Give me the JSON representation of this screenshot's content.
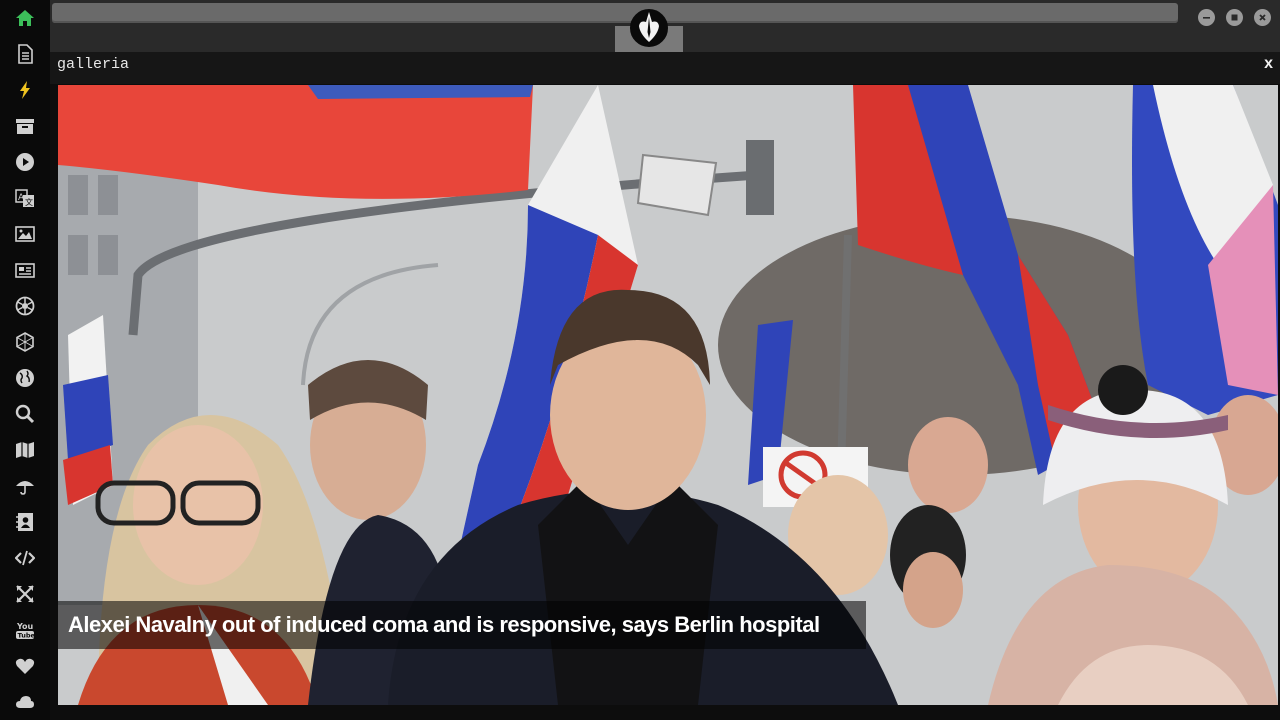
{
  "app": {
    "address_bar_value": "",
    "logo_icon": "rebel-alliance-icon",
    "window_controls": [
      "minimize-icon",
      "maximize-icon",
      "close-icon"
    ]
  },
  "sidebar": {
    "items": [
      {
        "icon": "home-icon",
        "color": "#3cbf5a"
      },
      {
        "icon": "document-icon",
        "color": "#d0d0d0"
      },
      {
        "icon": "lightning-icon",
        "color": "#f0c420"
      },
      {
        "icon": "archive-icon",
        "color": "#d0d0d0"
      },
      {
        "icon": "play-icon",
        "color": "#d0d0d0"
      },
      {
        "icon": "translate-icon",
        "color": "#d0d0d0"
      },
      {
        "icon": "image-icon",
        "color": "#d0d0d0"
      },
      {
        "icon": "newspaper-icon",
        "color": "#d0d0d0"
      },
      {
        "icon": "aperture-icon",
        "color": "#d0d0d0"
      },
      {
        "icon": "hexagon-icon",
        "color": "#d0d0d0"
      },
      {
        "icon": "globe-icon",
        "color": "#d0d0d0"
      },
      {
        "icon": "search-icon",
        "color": "#d0d0d0"
      },
      {
        "icon": "map-icon",
        "color": "#d0d0d0"
      },
      {
        "icon": "umbrella-icon",
        "color": "#d0d0d0"
      },
      {
        "icon": "contact-card-icon",
        "color": "#d0d0d0"
      },
      {
        "icon": "code-icon",
        "color": "#d0d0d0"
      },
      {
        "icon": "expand-icon",
        "color": "#d0d0d0"
      },
      {
        "icon": "youtube-icon",
        "color": "#d0d0d0"
      },
      {
        "icon": "heart-icon",
        "color": "#d0d0d0"
      },
      {
        "icon": "cloud-icon",
        "color": "#d0d0d0"
      }
    ]
  },
  "gallery": {
    "title": "galleria",
    "close_label": "x",
    "caption": "Alexei Navalny out of induced coma and is responsive, says Berlin hospital"
  }
}
